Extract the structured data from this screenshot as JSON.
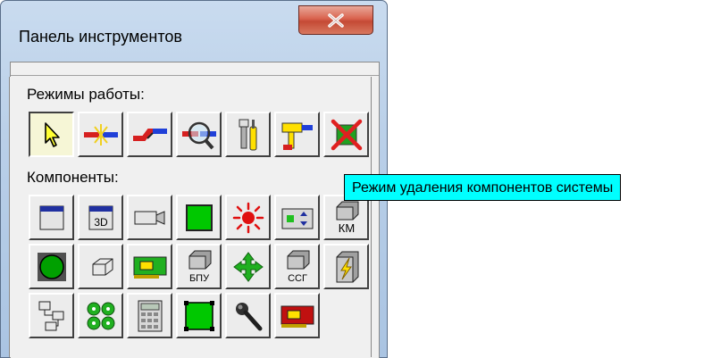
{
  "window": {
    "title": "Панель инструментов",
    "close_label": "x"
  },
  "groups": {
    "modes_label": "Режимы работы:",
    "components_label": "Компоненты:"
  },
  "mode_buttons": [
    {
      "icon": "pointer-arrow-icon"
    },
    {
      "icon": "link-connect-icon"
    },
    {
      "icon": "link-break-icon"
    },
    {
      "icon": "magnify-link-icon"
    },
    {
      "icon": "tools-properties-icon"
    },
    {
      "icon": "paint-bucket-icon"
    },
    {
      "icon": "delete-red-x-icon"
    }
  ],
  "component_buttons": [
    {
      "icon": "window-panel-icon",
      "text": ""
    },
    {
      "icon": "3d-panel-icon",
      "text": "3D"
    },
    {
      "icon": "camera-icon",
      "text": ""
    },
    {
      "icon": "green-square-icon",
      "text": ""
    },
    {
      "icon": "red-sun-icon",
      "text": ""
    },
    {
      "icon": "display-arrows-icon",
      "text": ""
    },
    {
      "icon": "km-box-icon",
      "text": "КМ"
    },
    {
      "icon": "green-circle-icon",
      "text": ""
    },
    {
      "icon": "eraser-cube-icon",
      "text": ""
    },
    {
      "icon": "board-card-icon",
      "text": ""
    },
    {
      "icon": "bpu-box-icon",
      "text": "БПУ"
    },
    {
      "icon": "green-arrows-icon",
      "text": ""
    },
    {
      "icon": "ssg-box-icon",
      "text": "ССГ"
    },
    {
      "icon": "lightning-panel-icon",
      "text": ""
    },
    {
      "icon": "hierarchy-icon",
      "text": ""
    },
    {
      "icon": "four-green-circles-icon",
      "text": ""
    },
    {
      "icon": "calculator-icon",
      "text": ""
    },
    {
      "icon": "green-square-corners-icon",
      "text": ""
    },
    {
      "icon": "microphone-icon",
      "text": ""
    },
    {
      "icon": "red-board-icon",
      "text": ""
    }
  ],
  "tooltip": {
    "text": "Режим удаления компонентов системы"
  },
  "colors": {
    "tooltip_bg": "#00ffff",
    "close_btn": "#c44a35",
    "pressed_btn": "#f6f6d6"
  }
}
